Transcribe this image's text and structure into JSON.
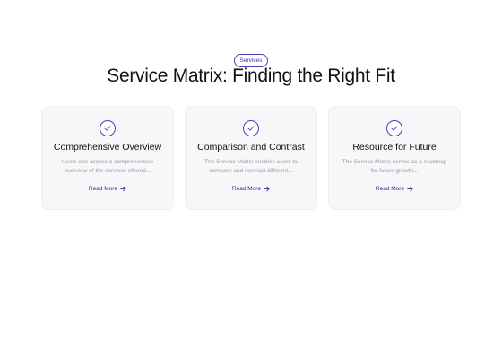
{
  "header": {
    "badge": "Services",
    "title": "Service Matrix: Finding the Right Fit"
  },
  "cards": [
    {
      "icon": "check-circle-icon",
      "title": "Comprehensive Overview",
      "description": "Users can access a comprehensive overview of the services offered...",
      "link": "Read More"
    },
    {
      "icon": "check-circle-icon",
      "title": "Comparison and Contrast",
      "description": "The Service Matrix enables users to compare and contrast different...",
      "link": "Read More"
    },
    {
      "icon": "check-circle-icon",
      "title": "Resource for Future",
      "description": "The Service Matrix serves as a roadmap for future growth...",
      "link": "Read More"
    }
  ],
  "colors": {
    "accent": "#4a41b8",
    "link": "#2f2a8c",
    "card_background": "#f7f7f9",
    "muted_text": "#9a9aa3"
  }
}
